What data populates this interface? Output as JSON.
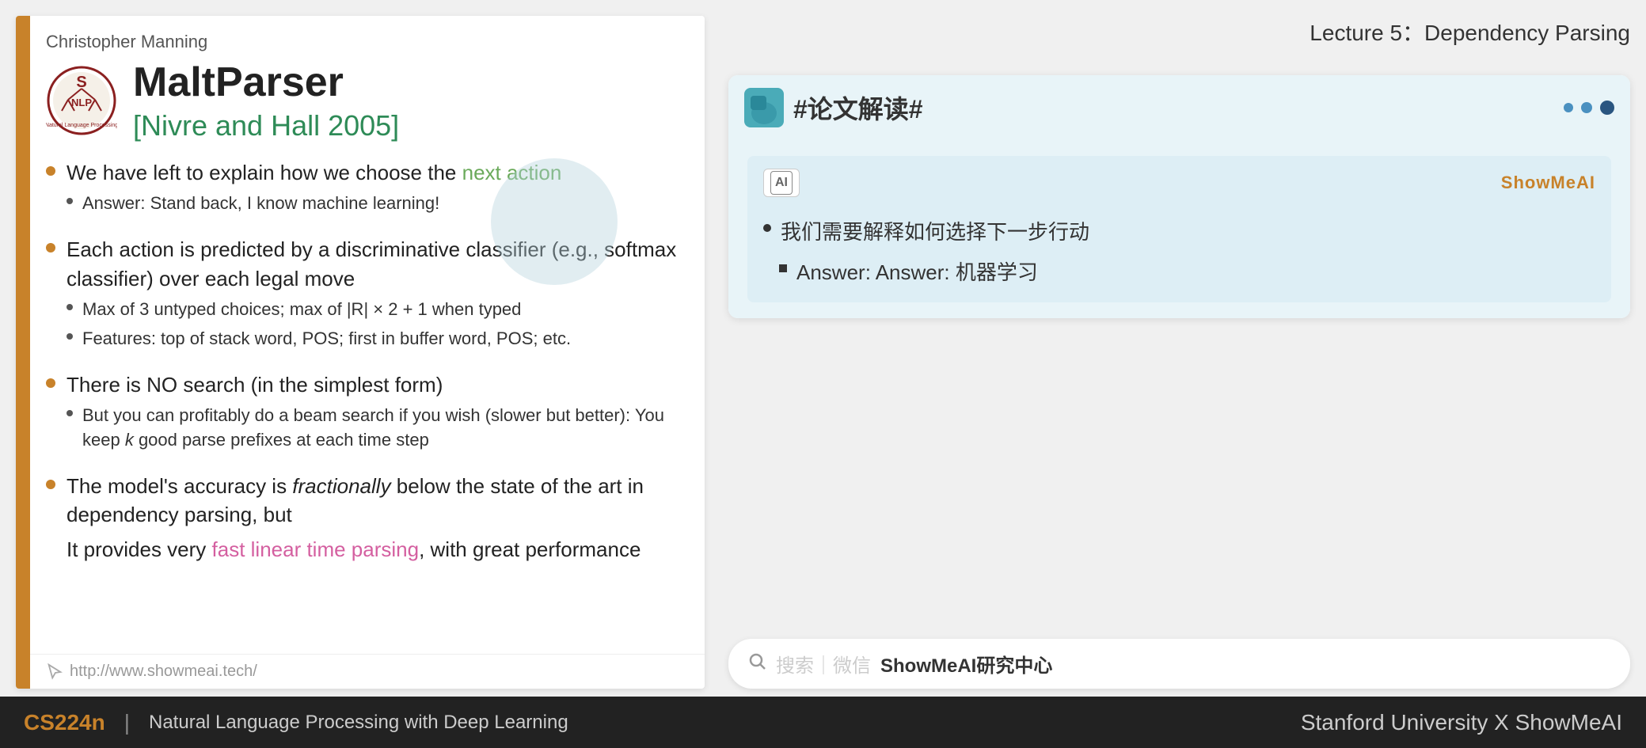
{
  "lecture": {
    "title": "Lecture 5：Dependency Parsing"
  },
  "slide": {
    "author": "Christopher Manning",
    "title": "MaltParser",
    "subtitle": "[Nivre and Hall 2005]",
    "bullets": [
      {
        "text": "We have left to explain how we choose the ",
        "highlight": "next action",
        "sub": [
          "Answer: Stand back, I know machine learning!"
        ]
      },
      {
        "text": "Each action is predicted by a discriminative classifier (e.g., softmax classifier) over each legal move",
        "sub": [
          "Max of 3 untyped choices; max of |R| × 2 + 1 when typed",
          "Features: top of stack word, POS; first in buffer word, POS; etc."
        ]
      },
      {
        "text": "There is NO search (in the simplest form)",
        "sub": [
          "But you can profitably do a beam search if you wish (slower but better): You keep k good parse prefixes at each time step"
        ]
      },
      {
        "text_before": "The model's accuracy is ",
        "text_italic": "fractionally",
        "text_after": " below the state of the art in dependency parsing, but",
        "text_line2_before": "It provides very ",
        "text_line2_highlight": "fast linear time parsing",
        "text_line2_after": ", with great performance"
      }
    ],
    "footer_url": "http://www.showmeai.tech/"
  },
  "annotation": {
    "header_title": "#论文解读#",
    "ai_badge": "⊙",
    "showmeai_label": "ShowMeAI",
    "bullet1": "我们需要解释如何选择下一步行动",
    "sub_bullet1": "Answer: 机器学习"
  },
  "search": {
    "icon": "🔍",
    "divider": "|",
    "text": "搜索｜微信 ShowMeAI研究中心"
  },
  "footer": {
    "cs224n": "CS224n",
    "divider": "|",
    "description": "Natural Language Processing with Deep Learning",
    "right": "Stanford University X ShowMeAI"
  },
  "dots": {
    "small_label": "·"
  }
}
